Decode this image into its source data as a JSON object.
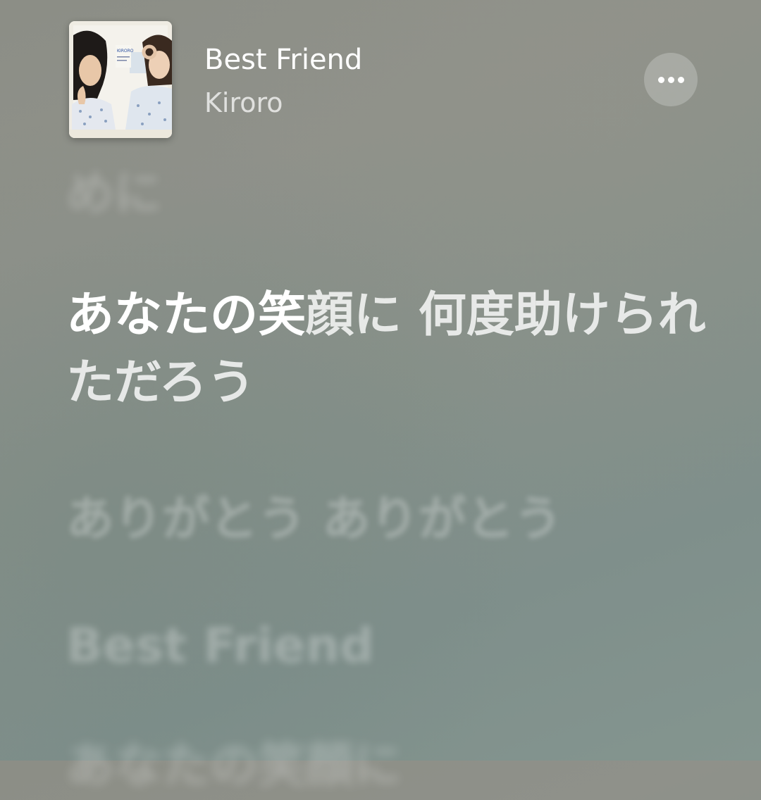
{
  "track": {
    "title": "Best Friend",
    "artist": "Kiroro",
    "album_art_text": "KIRORO"
  },
  "actions": {
    "more_icon": "ellipsis-icon"
  },
  "lyrics": {
    "previous": "めに",
    "current_sung": "あなたの笑",
    "current_unsung": "顔に 何度助けられただろう",
    "next_1": "ありがとう ありがとう",
    "next_2": "Best Friend",
    "next_3": "あなたの笑顔に"
  },
  "colors": {
    "background": "#8b918b",
    "text_primary": "#ffffff"
  }
}
